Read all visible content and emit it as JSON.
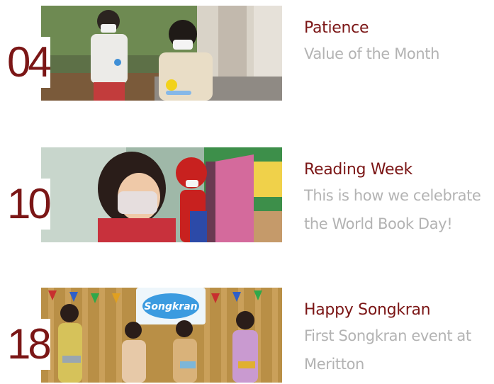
{
  "events": [
    {
      "day": "04",
      "title": "Patience",
      "description": "Value of the Month",
      "image_icon": "photo-children-playing-icon"
    },
    {
      "day": "10",
      "title": "Reading Week",
      "description": "This is how we celebrate the World Book Day!",
      "image_icon": "photo-reading-week-icon"
    },
    {
      "day": "18",
      "title": "Happy Songkran",
      "description": "First Songkran event at Meritton",
      "image_icon": "photo-songkran-festival-icon",
      "banner_text": "Songkran"
    }
  ],
  "colors": {
    "accent": "#7b1616",
    "muted_text": "#b3b3b3",
    "background": "#ffffff"
  }
}
